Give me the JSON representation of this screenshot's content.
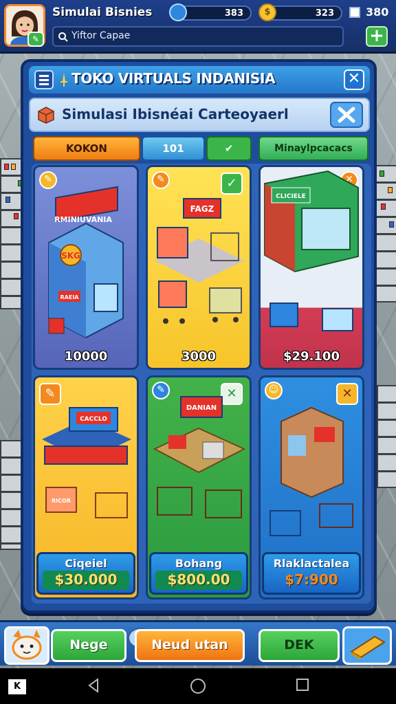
{
  "header": {
    "app_title": "Simulai Bisnies",
    "gem_count": "383",
    "coin_count": "323",
    "stat_count": "380",
    "search_text": "Yiftor Capae"
  },
  "panel": {
    "title": "TOKO VIRTUALS INDANISIA",
    "subtitle": "Simulasi Ibisnéai Carteoyaerl"
  },
  "tabs": [
    {
      "label": "KOKON"
    },
    {
      "label": "101"
    },
    {
      "label": "Minaylpcacacs"
    }
  ],
  "cards": [
    {
      "price": "10000",
      "sign": "RMINIUVANIA",
      "badge": "SKG",
      "base": "RAEIA"
    },
    {
      "price": "3000",
      "sign": "FAGZ"
    },
    {
      "price": "$29.100",
      "sign": "CLICIELE"
    },
    {
      "label": "Ciqeiel",
      "value": "$30.000",
      "sign": "CACCLO",
      "base": "RICOR"
    },
    {
      "label": "Bohang",
      "value": "$800.00",
      "sign": "DANIAN"
    },
    {
      "label": "Rlaklactalea",
      "value": "$7:900"
    }
  ],
  "bottom": {
    "left_button": "Nege",
    "middle_button": "Neud utan",
    "right_button": "DEK"
  },
  "colors": {
    "accent": "#1f4d9e",
    "green": "#3bb54a",
    "orange": "#f28a1e"
  }
}
